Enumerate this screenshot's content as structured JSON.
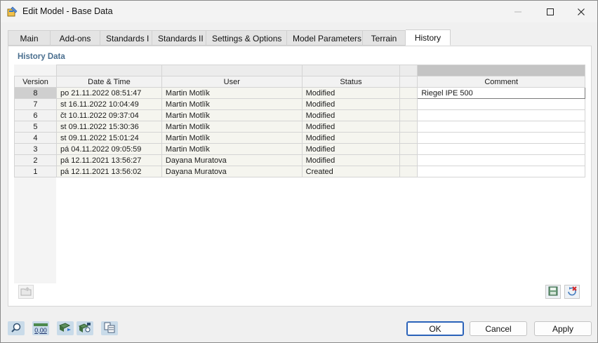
{
  "window": {
    "title": "Edit Model - Base Data"
  },
  "tabs": [
    {
      "label": "Main"
    },
    {
      "label": "Add-ons"
    },
    {
      "label": "Standards I"
    },
    {
      "label": "Standards II"
    },
    {
      "label": "Settings & Options"
    },
    {
      "label": "Model Parameters"
    },
    {
      "label": "Terrain"
    },
    {
      "label": "History",
      "active": true
    }
  ],
  "history": {
    "group_title": "History Data",
    "columns": {
      "version": "Version",
      "datetime": "Date & Time",
      "user": "User",
      "status": "Status",
      "comment": "Comment"
    },
    "rows": [
      {
        "version": "8",
        "datetime": "po 21.11.2022 08:51:47",
        "user": "Martin Motlík",
        "status": "Modified",
        "comment": "Riegel IPE 500"
      },
      {
        "version": "7",
        "datetime": "st 16.11.2022 10:04:49",
        "user": "Martin Motlík",
        "status": "Modified",
        "comment": ""
      },
      {
        "version": "6",
        "datetime": "čt 10.11.2022 09:37:04",
        "user": "Martin Motlík",
        "status": "Modified",
        "comment": ""
      },
      {
        "version": "5",
        "datetime": "st 09.11.2022 15:30:36",
        "user": "Martin Motlík",
        "status": "Modified",
        "comment": ""
      },
      {
        "version": "4",
        "datetime": "st 09.11.2022 15:01:24",
        "user": "Martin Motlík",
        "status": "Modified",
        "comment": ""
      },
      {
        "version": "3",
        "datetime": "pá 04.11.2022 09:05:59",
        "user": "Martin Motlík",
        "status": "Modified",
        "comment": ""
      },
      {
        "version": "2",
        "datetime": "pá 12.11.2021 13:56:27",
        "user": "Dayana Muratova",
        "status": "Modified",
        "comment": ""
      },
      {
        "version": "1",
        "datetime": "pá 12.11.2021 13:56:02",
        "user": "Dayana Muratova",
        "status": "Created",
        "comment": ""
      }
    ]
  },
  "footer": {
    "zero_value": "0,00",
    "ok_label": "OK",
    "cancel_label": "Cancel",
    "apply_label": "Apply"
  },
  "icons": {
    "app": "model-edit-icon",
    "panel_left": "export-folder-icon",
    "panel_right": [
      "save-version-icon",
      "delete-version-icon"
    ],
    "bottom": [
      "search-zoom-icon",
      "decimal-format-icon",
      "model-view-icon",
      "model-settings-icon",
      "data-table-icon"
    ]
  },
  "colors": {
    "accent": "#2a62b9",
    "group_title": "#4a6f8f",
    "selected_row": "#cfcfcf"
  }
}
